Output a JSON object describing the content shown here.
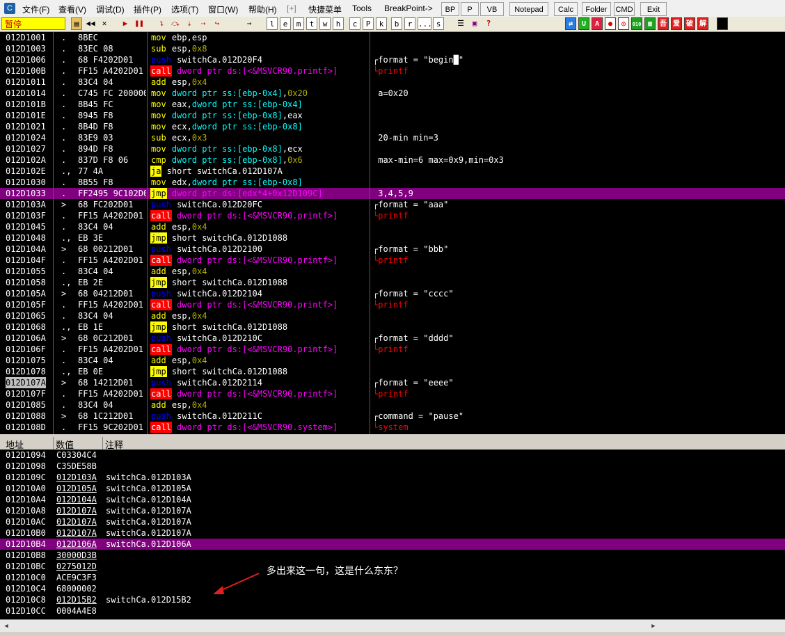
{
  "menu": {
    "items": [
      "文件(F)",
      "查看(V)",
      "调试(D)",
      "插件(P)",
      "选项(T)",
      "窗口(W)",
      "帮助(H)",
      "[+]",
      "快捷菜单",
      "Tools",
      "BreakPoint->"
    ],
    "buttons": [
      "BP",
      "P",
      "VB",
      "Notepad",
      "Calc",
      "Folder",
      "CMD",
      "Exit"
    ]
  },
  "toolbar": {
    "status": "暂停",
    "letter_buttons": [
      "l",
      "e",
      "m",
      "t",
      "w",
      "h",
      "c",
      "P",
      "k",
      "b",
      "r",
      "...",
      "s"
    ],
    "help_button": "?"
  },
  "disasm": {
    "rows": [
      {
        "addr": "012D1001",
        "mark": ".",
        "hex": "8BEC",
        "asm": [
          [
            "mov",
            "mn-mov"
          ],
          [
            " "
          ],
          [
            "ebp",
            "op-reg"
          ],
          [
            ","
          ],
          [
            "esp",
            "op-reg"
          ]
        ],
        "cmt": ""
      },
      {
        "addr": "012D1003",
        "mark": ".",
        "hex": "83EC 08",
        "asm": [
          [
            "sub",
            "mn-sub"
          ],
          [
            " "
          ],
          [
            "esp",
            "op-reg"
          ],
          [
            ","
          ],
          [
            "0x8",
            "op-num"
          ]
        ],
        "cmt": ""
      },
      {
        "addr": "012D1006",
        "mark": ".",
        "hex": "68 F4202D01",
        "asm": [
          [
            "push",
            "mn-push"
          ],
          [
            " switchCa.012D20F4",
            "op-reg"
          ]
        ],
        "cmt": "┌format = \"begin█\""
      },
      {
        "addr": "012D100B",
        "mark": ".",
        "hex": "FF15 A4202D01",
        "asm": [
          [
            "call",
            "mn-call"
          ],
          [
            " "
          ],
          [
            "dword ptr ds:[<&MSVCR90.printf>]",
            "op-api"
          ]
        ],
        "cmt": "└printf",
        "cmtcls": "cmt-api"
      },
      {
        "addr": "012D1011",
        "mark": ".",
        "hex": "83C4 04",
        "asm": [
          [
            "add",
            "mn-add"
          ],
          [
            " "
          ],
          [
            "esp",
            "op-reg"
          ],
          [
            ","
          ],
          [
            "0x4",
            "op-num"
          ]
        ],
        "cmt": ""
      },
      {
        "addr": "012D1014",
        "mark": ".",
        "hex": "C745 FC 20000000",
        "asm": [
          [
            "mov",
            "mn-mov"
          ],
          [
            " "
          ],
          [
            "dword ptr ss:[ebp-0x4]",
            "op-mem"
          ],
          [
            ","
          ],
          [
            "0x20",
            "op-num"
          ]
        ],
        "cmt": " a=0x20"
      },
      {
        "addr": "012D101B",
        "mark": ".",
        "hex": "8B45 FC",
        "asm": [
          [
            "mov",
            "mn-mov"
          ],
          [
            " "
          ],
          [
            "eax",
            "op-reg"
          ],
          [
            ","
          ],
          [
            "dword ptr ss:[ebp-0x4]",
            "op-mem"
          ]
        ],
        "cmt": ""
      },
      {
        "addr": "012D101E",
        "mark": ".",
        "hex": "8945 F8",
        "asm": [
          [
            "mov",
            "mn-mov"
          ],
          [
            " "
          ],
          [
            "dword ptr ss:[ebp-0x8]",
            "op-mem"
          ],
          [
            ","
          ],
          [
            "eax",
            "op-reg"
          ]
        ],
        "cmt": ""
      },
      {
        "addr": "012D1021",
        "mark": ".",
        "hex": "8B4D F8",
        "asm": [
          [
            "mov",
            "mn-mov"
          ],
          [
            " "
          ],
          [
            "ecx",
            "op-reg"
          ],
          [
            ","
          ],
          [
            "dword ptr ss:[ebp-0x8]",
            "op-mem"
          ]
        ],
        "cmt": ""
      },
      {
        "addr": "012D1024",
        "mark": ".",
        "hex": "83E9 03",
        "asm": [
          [
            "sub",
            "mn-sub"
          ],
          [
            " "
          ],
          [
            "ecx",
            "op-reg"
          ],
          [
            ","
          ],
          [
            "0x3",
            "op-num"
          ]
        ],
        "cmt": " 20-min min=3"
      },
      {
        "addr": "012D1027",
        "mark": ".",
        "hex": "894D F8",
        "asm": [
          [
            "mov",
            "mn-mov"
          ],
          [
            " "
          ],
          [
            "dword ptr ss:[ebp-0x8]",
            "op-mem"
          ],
          [
            ","
          ],
          [
            "ecx",
            "op-reg"
          ]
        ],
        "cmt": ""
      },
      {
        "addr": "012D102A",
        "mark": ".",
        "hex": "837D F8 06",
        "asm": [
          [
            "cmp",
            "mn-cmp"
          ],
          [
            " "
          ],
          [
            "dword ptr ss:[ebp-0x8]",
            "op-mem"
          ],
          [
            ","
          ],
          [
            "0x6",
            "op-num"
          ]
        ],
        "cmt": " max-min=6 max=0x9,min=0x3"
      },
      {
        "addr": "012D102E",
        "mark": ".,",
        "hex": "77 4A",
        "asm": [
          [
            "ja",
            "mn-ja"
          ],
          [
            " short switchCa.012D107A",
            "op-reg"
          ]
        ],
        "cmt": ""
      },
      {
        "addr": "012D1030",
        "mark": ".",
        "hex": "8B55 F8",
        "asm": [
          [
            "mov",
            "mn-mov"
          ],
          [
            " "
          ],
          [
            "edx",
            "op-reg"
          ],
          [
            ","
          ],
          [
            "dword ptr ss:[ebp-0x8]",
            "op-mem"
          ]
        ],
        "cmt": ""
      },
      {
        "addr": "012D1033",
        "mark": ".",
        "hex": "FF2495 9C102D01",
        "asm": [
          [
            "jmp",
            "mn-jmp"
          ],
          [
            " "
          ],
          [
            "dword ptr ds:[edx*4+0x12D109C]",
            "op-api"
          ]
        ],
        "cmt": " 3,4,5,9",
        "hl": true
      },
      {
        "addr": "012D103A",
        "mark": ">",
        "hex": "68 FC202D01",
        "asm": [
          [
            "push",
            "mn-push"
          ],
          [
            " switchCa.012D20FC",
            "op-reg"
          ]
        ],
        "cmt": "┌format = \"aaa\""
      },
      {
        "addr": "012D103F",
        "mark": ".",
        "hex": "FF15 A4202D01",
        "asm": [
          [
            "call",
            "mn-call"
          ],
          [
            " "
          ],
          [
            "dword ptr ds:[<&MSVCR90.printf>]",
            "op-api"
          ]
        ],
        "cmt": "└printf",
        "cmtcls": "cmt-api"
      },
      {
        "addr": "012D1045",
        "mark": ".",
        "hex": "83C4 04",
        "asm": [
          [
            "add",
            "mn-add"
          ],
          [
            " "
          ],
          [
            "esp",
            "op-reg"
          ],
          [
            ","
          ],
          [
            "0x4",
            "op-num"
          ]
        ],
        "cmt": ""
      },
      {
        "addr": "012D1048",
        "mark": ".,",
        "hex": "EB 3E",
        "asm": [
          [
            "jmp",
            "mn-jmp"
          ],
          [
            " short switchCa.012D1088",
            "op-reg"
          ]
        ],
        "cmt": ""
      },
      {
        "addr": "012D104A",
        "mark": ">",
        "hex": "68 00212D01",
        "asm": [
          [
            "push",
            "mn-push"
          ],
          [
            " switchCa.012D2100",
            "op-reg"
          ]
        ],
        "cmt": "┌format = \"bbb\""
      },
      {
        "addr": "012D104F",
        "mark": ".",
        "hex": "FF15 A4202D01",
        "asm": [
          [
            "call",
            "mn-call"
          ],
          [
            " "
          ],
          [
            "dword ptr ds:[<&MSVCR90.printf>]",
            "op-api"
          ]
        ],
        "cmt": "└printf",
        "cmtcls": "cmt-api"
      },
      {
        "addr": "012D1055",
        "mark": ".",
        "hex": "83C4 04",
        "asm": [
          [
            "add",
            "mn-add"
          ],
          [
            " "
          ],
          [
            "esp",
            "op-reg"
          ],
          [
            ","
          ],
          [
            "0x4",
            "op-num"
          ]
        ],
        "cmt": ""
      },
      {
        "addr": "012D1058",
        "mark": ".,",
        "hex": "EB 2E",
        "asm": [
          [
            "jmp",
            "mn-jmp"
          ],
          [
            " short switchCa.012D1088",
            "op-reg"
          ]
        ],
        "cmt": ""
      },
      {
        "addr": "012D105A",
        "mark": ">",
        "hex": "68 04212D01",
        "asm": [
          [
            "push",
            "mn-push"
          ],
          [
            " switchCa.012D2104",
            "op-reg"
          ]
        ],
        "cmt": "┌format = \"cccc\""
      },
      {
        "addr": "012D105F",
        "mark": ".",
        "hex": "FF15 A4202D01",
        "asm": [
          [
            "call",
            "mn-call"
          ],
          [
            " "
          ],
          [
            "dword ptr ds:[<&MSVCR90.printf>]",
            "op-api"
          ]
        ],
        "cmt": "└printf",
        "cmtcls": "cmt-api"
      },
      {
        "addr": "012D1065",
        "mark": ".",
        "hex": "83C4 04",
        "asm": [
          [
            "add",
            "mn-add"
          ],
          [
            " "
          ],
          [
            "esp",
            "op-reg"
          ],
          [
            ","
          ],
          [
            "0x4",
            "op-num"
          ]
        ],
        "cmt": ""
      },
      {
        "addr": "012D1068",
        "mark": ".,",
        "hex": "EB 1E",
        "asm": [
          [
            "jmp",
            "mn-jmp"
          ],
          [
            " short switchCa.012D1088",
            "op-reg"
          ]
        ],
        "cmt": ""
      },
      {
        "addr": "012D106A",
        "mark": ">",
        "hex": "68 0C212D01",
        "asm": [
          [
            "push",
            "mn-push"
          ],
          [
            " switchCa.012D210C",
            "op-reg"
          ]
        ],
        "cmt": "┌format = \"dddd\""
      },
      {
        "addr": "012D106F",
        "mark": ".",
        "hex": "FF15 A4202D01",
        "asm": [
          [
            "call",
            "mn-call"
          ],
          [
            " "
          ],
          [
            "dword ptr ds:[<&MSVCR90.printf>]",
            "op-api"
          ]
        ],
        "cmt": "└printf",
        "cmtcls": "cmt-api"
      },
      {
        "addr": "012D1075",
        "mark": ".",
        "hex": "83C4 04",
        "asm": [
          [
            "add",
            "mn-add"
          ],
          [
            " "
          ],
          [
            "esp",
            "op-reg"
          ],
          [
            ","
          ],
          [
            "0x4",
            "op-num"
          ]
        ],
        "cmt": ""
      },
      {
        "addr": "012D1078",
        "mark": ".,",
        "hex": "EB 0E",
        "asm": [
          [
            "jmp",
            "mn-jmp"
          ],
          [
            " short switchCa.012D1088",
            "op-reg"
          ]
        ],
        "cmt": ""
      },
      {
        "addr": "012D107A",
        "mark": ">",
        "hex": "68 14212D01",
        "asm": [
          [
            "push",
            "mn-push"
          ],
          [
            " switchCa.012D2114",
            "op-reg"
          ]
        ],
        "cmt": "┌format = \"eeee\"",
        "addrhl": true
      },
      {
        "addr": "012D107F",
        "mark": ".",
        "hex": "FF15 A4202D01",
        "asm": [
          [
            "call",
            "mn-call"
          ],
          [
            " "
          ],
          [
            "dword ptr ds:[<&MSVCR90.printf>]",
            "op-api"
          ]
        ],
        "cmt": "└printf",
        "cmtcls": "cmt-api"
      },
      {
        "addr": "012D1085",
        "mark": ".",
        "hex": "83C4 04",
        "asm": [
          [
            "add",
            "mn-add"
          ],
          [
            " "
          ],
          [
            "esp",
            "op-reg"
          ],
          [
            ","
          ],
          [
            "0x4",
            "op-num"
          ]
        ],
        "cmt": ""
      },
      {
        "addr": "012D1088",
        "mark": ">",
        "hex": "68 1C212D01",
        "asm": [
          [
            "push",
            "mn-push"
          ],
          [
            " switchCa.012D211C",
            "op-reg"
          ]
        ],
        "cmt": "┌command = \"pause\""
      },
      {
        "addr": "012D108D",
        "mark": ".",
        "hex": "FF15 9C202D01",
        "asm": [
          [
            "call",
            "mn-call"
          ],
          [
            " "
          ],
          [
            "dword ptr ds:[<&MSVCR90.system>]",
            "op-api"
          ]
        ],
        "cmt": "└system",
        "cmtcls": "cmt-api"
      }
    ]
  },
  "dump": {
    "headers": [
      "地址",
      "数值",
      "注释"
    ],
    "rows": [
      {
        "addr": "012D1094",
        "val": "C03304C4",
        "cmt": ""
      },
      {
        "addr": "012D1098",
        "val": "C35DE58B",
        "cmt": ""
      },
      {
        "addr": "012D109C",
        "val": "012D103A",
        "cmt": "switchCa.012D103A",
        "ul": true
      },
      {
        "addr": "012D10A0",
        "val": "012D105A",
        "cmt": "switchCa.012D105A",
        "ul": true
      },
      {
        "addr": "012D10A4",
        "val": "012D104A",
        "cmt": "switchCa.012D104A",
        "ul": true
      },
      {
        "addr": "012D10A8",
        "val": "012D107A",
        "cmt": "switchCa.012D107A",
        "ul": true
      },
      {
        "addr": "012D10AC",
        "val": "012D107A",
        "cmt": "switchCa.012D107A",
        "ul": true
      },
      {
        "addr": "012D10B0",
        "val": "012D107A",
        "cmt": "switchCa.012D107A",
        "ul": true
      },
      {
        "addr": "012D10B4",
        "val": "012D106A",
        "cmt": "switchCa.012D106A",
        "ul": true,
        "hl": true
      },
      {
        "addr": "012D10B8",
        "val": "30000D3B",
        "cmt": "",
        "ul": true
      },
      {
        "addr": "012D10BC",
        "val": "0275012D",
        "cmt": "",
        "ul": true
      },
      {
        "addr": "012D10C0",
        "val": "ACE9C3F3",
        "cmt": ""
      },
      {
        "addr": "012D10C4",
        "val": "68000002",
        "cmt": ""
      },
      {
        "addr": "012D10C8",
        "val": "012D15B2",
        "cmt": "switchCa.012D15B2",
        "ul": true
      },
      {
        "addr": "012D10CC",
        "val": "0004A4E8",
        "cmt": ""
      }
    ]
  },
  "annotation": "多出来这一句，这是什么东东？"
}
